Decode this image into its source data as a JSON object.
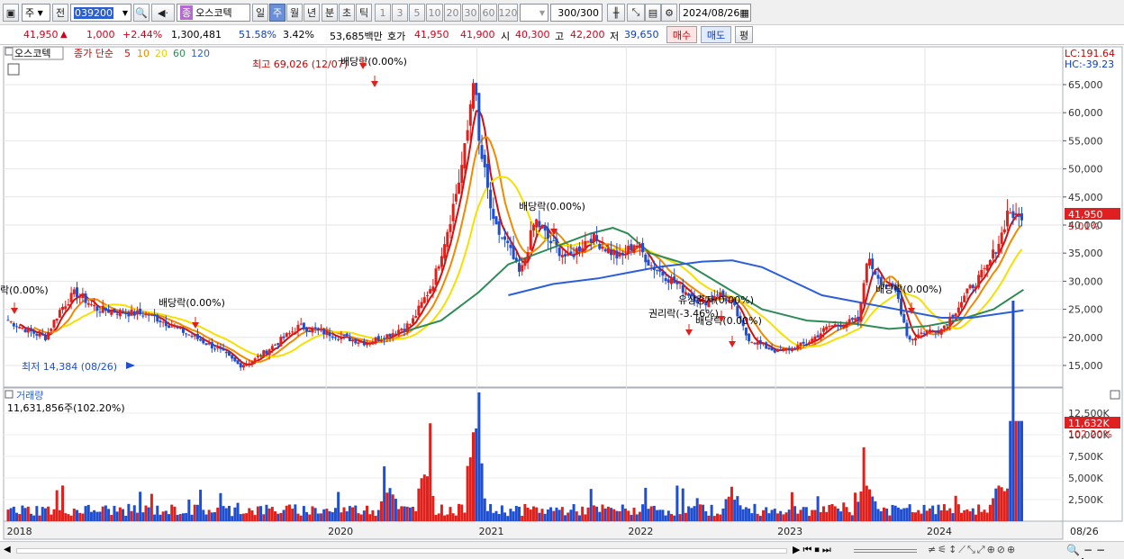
{
  "toolbar": {
    "type_select": "주",
    "prev_label": "전",
    "code": "039200",
    "name": "오스코텍",
    "name_badge": "종",
    "periods": [
      "일",
      "주",
      "월",
      "년",
      "분",
      "초",
      "틱"
    ],
    "active_period": "주",
    "intervals": [
      "1",
      "3",
      "5",
      "10",
      "20",
      "30",
      "60",
      "120"
    ],
    "count": "300",
    "count_total": "/300",
    "date": "2024/08/26"
  },
  "quote": {
    "price": "41,950",
    "arrow": "▲",
    "change": "1,000",
    "change_pct": "+2.44%",
    "volume": "1,300,481",
    "vol_ratio": "51.58%",
    "turnover": "3.42%",
    "amount": "53,685백만",
    "ask_label": "호가",
    "ask": "41,950",
    "bid": "41,900",
    "open_label": "시",
    "open": "40,300",
    "high_label": "고",
    "high": "42,200",
    "low_label": "저",
    "low": "39,650",
    "buy_label": "매수",
    "sell_label": "매도",
    "eval_label": "평"
  },
  "price_panel": {
    "name": "오스코텍",
    "series_label": "종가 단순",
    "ma_periods": [
      "5",
      "10",
      "20",
      "60",
      "120"
    ],
    "ma_colors": [
      "#d01010",
      "#f08a00",
      "#f5e000",
      "#2e8b57",
      "#2b5fd9"
    ],
    "lc": "LC:191.64",
    "hc": "HC:-39.23",
    "current_price": "41,950",
    "current_pct": "5.01%",
    "annotations": [
      "최고 69,026 (12/07)",
      "배당락(0.00%)",
      "배당락(0.00%)",
      "락(0.00%)",
      "배당락(0.00%)",
      "최저 14,384 (08/26)",
      "유상증자(0.00%)",
      "권리락(-3.46%)",
      "배당락(0.00%)",
      "배당락(0.00%)"
    ]
  },
  "volume_panel": {
    "title": "거래량",
    "summary": "11,631,856주(102.20%)",
    "current": "11,632K",
    "current_pct": "102.20%"
  },
  "chart_data": [
    {
      "type": "candlestick",
      "title": "오스코텍",
      "x_labels": [
        "2018",
        "2020",
        "2021",
        "2022",
        "2023",
        "2024",
        "08/26"
      ],
      "y_ticks": [
        15000,
        20000,
        25000,
        30000,
        35000,
        40000,
        45000,
        50000,
        55000,
        60000,
        65000
      ],
      "ylim": [
        10000,
        70000
      ],
      "close_path": [
        [
          2017.85,
          23000
        ],
        [
          2018.0,
          21000
        ],
        [
          2018.1,
          20000
        ],
        [
          2018.2,
          25000
        ],
        [
          2018.3,
          28000
        ],
        [
          2018.45,
          25000
        ],
        [
          2018.6,
          24500
        ],
        [
          2018.8,
          24000
        ],
        [
          2018.95,
          22000
        ],
        [
          2019.1,
          20000
        ],
        [
          2019.25,
          18000
        ],
        [
          2019.4,
          15000
        ],
        [
          2019.5,
          16000
        ],
        [
          2019.65,
          19000
        ],
        [
          2019.8,
          22000
        ],
        [
          2019.95,
          21000
        ],
        [
          2020.1,
          20000
        ],
        [
          2020.25,
          19000
        ],
        [
          2020.4,
          20500
        ],
        [
          2020.55,
          22500
        ],
        [
          2020.7,
          30000
        ],
        [
          2020.8,
          40000
        ],
        [
          2020.87,
          48000
        ],
        [
          2020.92,
          55000
        ],
        [
          2020.97,
          68000
        ],
        [
          2021.0,
          55000
        ],
        [
          2021.05,
          48000
        ],
        [
          2021.1,
          40000
        ],
        [
          2021.2,
          36000
        ],
        [
          2021.28,
          31000
        ],
        [
          2021.38,
          41000
        ],
        [
          2021.48,
          37000
        ],
        [
          2021.6,
          34000
        ],
        [
          2021.75,
          38000
        ],
        [
          2021.85,
          36000
        ],
        [
          2021.95,
          34000
        ],
        [
          2022.05,
          37000
        ],
        [
          2022.15,
          33000
        ],
        [
          2022.3,
          30000
        ],
        [
          2022.4,
          28000
        ],
        [
          2022.5,
          26000
        ],
        [
          2022.6,
          28000
        ],
        [
          2022.7,
          26000
        ],
        [
          2022.8,
          20000
        ],
        [
          2022.9,
          18500
        ],
        [
          2023.0,
          17500
        ],
        [
          2023.1,
          18000
        ],
        [
          2023.2,
          19000
        ],
        [
          2023.35,
          22000
        ],
        [
          2023.45,
          22500
        ],
        [
          2023.55,
          23000
        ],
        [
          2023.6,
          34000
        ],
        [
          2023.7,
          30000
        ],
        [
          2023.8,
          28000
        ],
        [
          2023.88,
          19500
        ],
        [
          2023.98,
          21000
        ],
        [
          2024.1,
          21500
        ],
        [
          2024.2,
          25000
        ],
        [
          2024.3,
          29000
        ],
        [
          2024.4,
          32000
        ],
        [
          2024.5,
          38000
        ],
        [
          2024.55,
          43000
        ],
        [
          2024.6,
          41000
        ],
        [
          2024.65,
          41950
        ]
      ],
      "ma_labels": [
        "5",
        "10",
        "20",
        "60",
        "120"
      ],
      "ma60_path": [
        [
          2020.5,
          21000
        ],
        [
          2020.75,
          23000
        ],
        [
          2021.0,
          28000
        ],
        [
          2021.2,
          33000
        ],
        [
          2021.5,
          36000
        ],
        [
          2021.75,
          38500
        ],
        [
          2021.9,
          39500
        ],
        [
          2022.0,
          38500
        ],
        [
          2022.15,
          35000
        ],
        [
          2022.4,
          33000
        ],
        [
          2022.65,
          29000
        ],
        [
          2022.9,
          25000
        ],
        [
          2023.2,
          23000
        ],
        [
          2023.5,
          22500
        ],
        [
          2023.75,
          21500
        ],
        [
          2024.0,
          22000
        ],
        [
          2024.2,
          23000
        ],
        [
          2024.45,
          25000
        ],
        [
          2024.65,
          28500
        ]
      ],
      "ma120_path": [
        [
          2021.2,
          27500
        ],
        [
          2021.5,
          29500
        ],
        [
          2021.8,
          30500
        ],
        [
          2022.0,
          31500
        ],
        [
          2022.2,
          32500
        ],
        [
          2022.5,
          33500
        ],
        [
          2022.7,
          33700
        ],
        [
          2022.9,
          32500
        ],
        [
          2023.1,
          30000
        ],
        [
          2023.3,
          27500
        ],
        [
          2023.6,
          26000
        ],
        [
          2023.9,
          24500
        ],
        [
          2024.1,
          23500
        ],
        [
          2024.3,
          23500
        ],
        [
          2024.65,
          24800
        ]
      ]
    },
    {
      "type": "bar",
      "title": "거래량",
      "y_ticks": [
        "2,500K",
        "5,000K",
        "7,500K",
        "10,000K",
        "12,500K"
      ],
      "ylim": [
        0,
        14000
      ],
      "peak_values_k": [
        [
          2020.4,
          5200
        ],
        [
          2020.65,
          7800
        ],
        [
          2020.97,
          14500
        ],
        [
          2021.0,
          6000
        ],
        [
          2022.7,
          4500
        ],
        [
          2023.6,
          6500
        ],
        [
          2024.5,
          6500
        ],
        [
          2024.6,
          12000
        ]
      ]
    }
  ]
}
